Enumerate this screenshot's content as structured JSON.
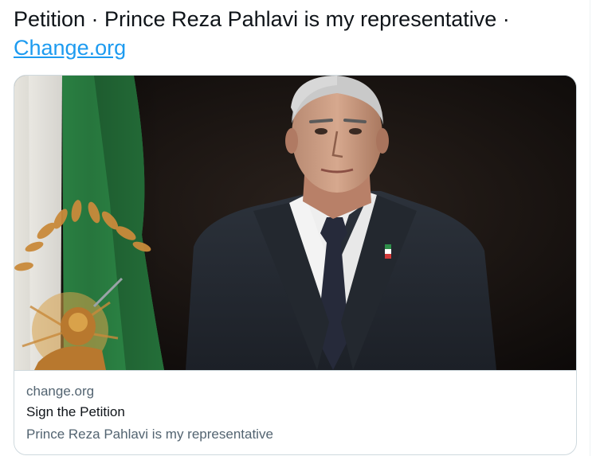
{
  "tweet": {
    "text": "Petition · Prince Reza Pahlavi is my representative · ",
    "link_text": "Change.org"
  },
  "card": {
    "image_alt": "Portrait photo of a man in a dark suit beside a green-white flag",
    "domain": "change.org",
    "title": "Sign the Petition",
    "description": "Prince Reza Pahlavi is my representative"
  },
  "colors": {
    "link": "#1d9bf0",
    "text": "#0f1419",
    "secondary_text": "#536471",
    "border": "#cfd9de"
  }
}
